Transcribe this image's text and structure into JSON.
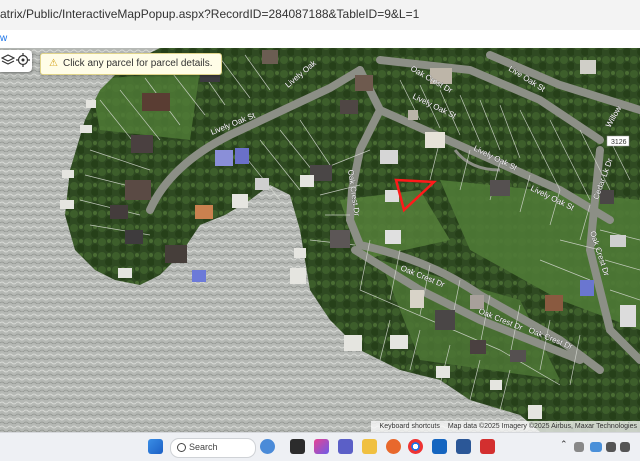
{
  "browser": {
    "url": "atrix/Public/InteractiveMapPopup.aspx?RecordID=284087188&TableID=9&L=1",
    "view_link": "w"
  },
  "map": {
    "tooltip": "Click any parcel for parcel details.",
    "attribution": {
      "shortcuts": "Keyboard shortcuts",
      "data": "Map data ©2025 Imagery ©2025 Airbus, Maxar Technologies"
    },
    "road_labels": {
      "lively_oak_1": "Lively Oak St",
      "lively_oak_2": "Lively Oak St",
      "lively_oak_3": "Lively Oak St",
      "lively_oak_4": "Lively Oak St",
      "oak_crest_1": "Oak Crest Dr",
      "oak_crest_2": "Oak Crest Dr",
      "oak_crest_3": "Oak Crest Dr",
      "oak_crest_4": "Oak Crest Dr",
      "oak_crest_5": "Oak Crest Dr",
      "oak_crest_6": "Oak Crest Dr",
      "live_oak": "Live Oak St",
      "cedar": "Cedar Lk Dr",
      "willow": "Willow",
      "route": "3126",
      "lively_oak_top": "Lively Oak"
    },
    "selected_parcel_color": "#ff1a1a"
  },
  "taskbar": {
    "search_placeholder": "Search"
  }
}
